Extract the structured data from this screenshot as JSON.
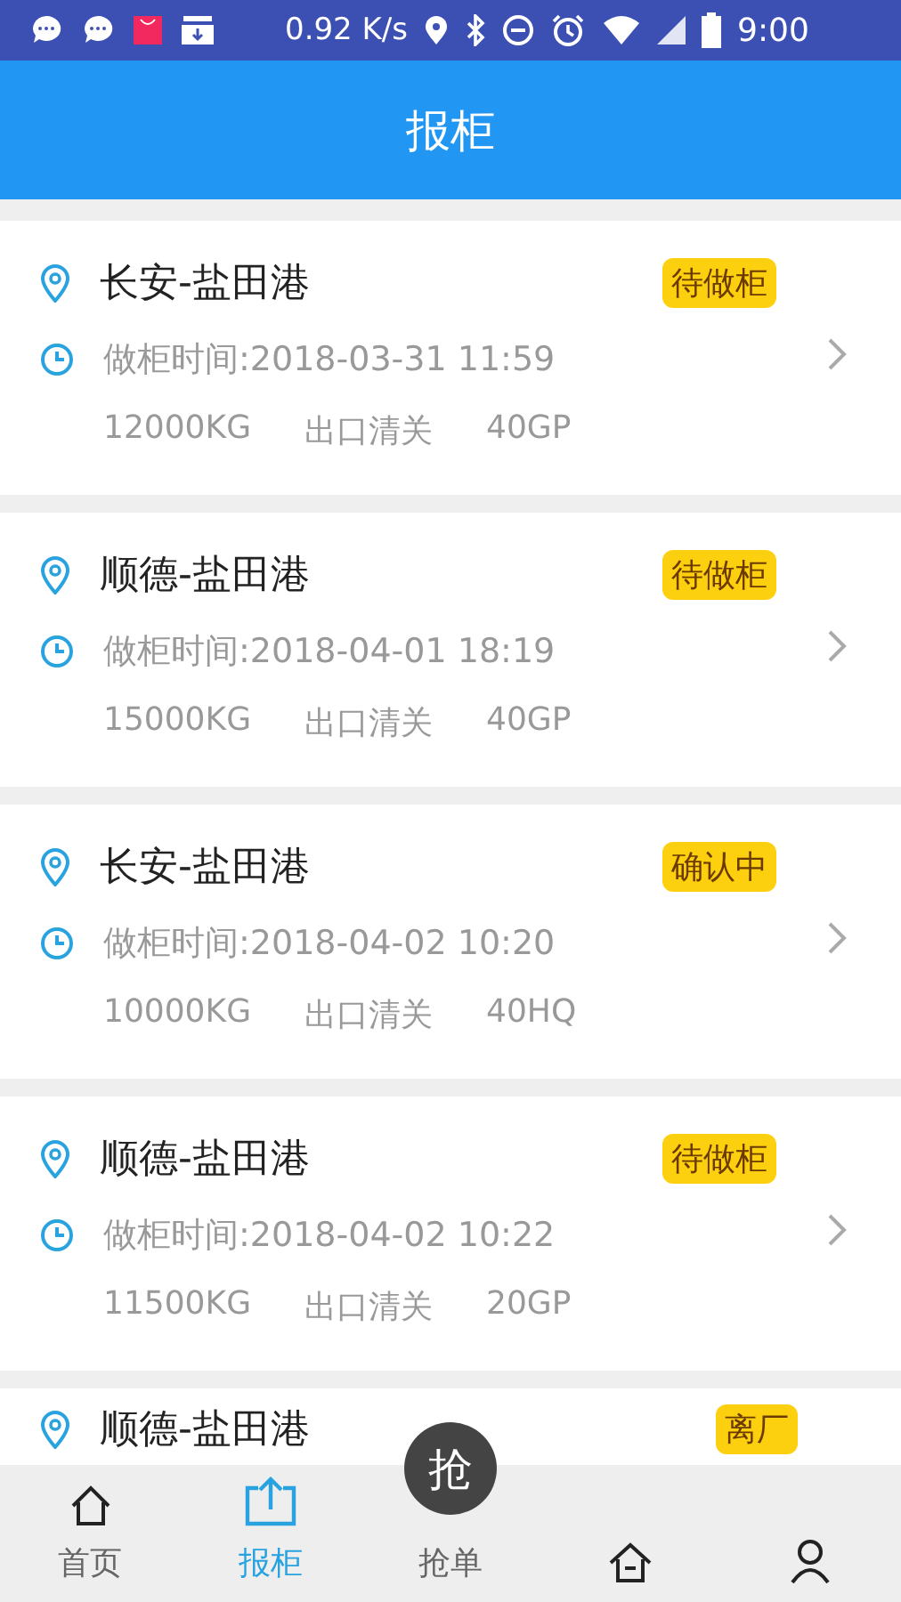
{
  "status_bar": {
    "speed": "0.92 K/s",
    "time": "9:00"
  },
  "header": {
    "title": "报柜"
  },
  "orders": [
    {
      "route": "长安-盐田港",
      "status": "待做柜",
      "time": "做柜时间:2018-03-31 11:59",
      "weight": "12000KG",
      "customs": "出口清关",
      "container": "40GP"
    },
    {
      "route": "顺德-盐田港",
      "status": "待做柜",
      "time": "做柜时间:2018-04-01 18:19",
      "weight": "15000KG",
      "customs": "出口清关",
      "container": "40GP"
    },
    {
      "route": "长安-盐田港",
      "status": "确认中",
      "time": "做柜时间:2018-04-02 10:20",
      "weight": "10000KG",
      "customs": "出口清关",
      "container": "40HQ"
    },
    {
      "route": "顺德-盐田港",
      "status": "待做柜",
      "time": "做柜时间:2018-04-02 10:22",
      "weight": "11500KG",
      "customs": "出口清关",
      "container": "20GP"
    },
    {
      "route": "顺德-盐田港",
      "status": "离厂"
    }
  ],
  "tabs": [
    {
      "kind": "home",
      "label": "首页",
      "selected": false
    },
    {
      "kind": "upload",
      "label": "报柜",
      "selected": true
    },
    {
      "kind": "grab",
      "badge": "抢",
      "label": "抢单",
      "selected": false
    },
    {
      "kind": "house",
      "selected": false
    },
    {
      "kind": "person",
      "selected": false
    }
  ]
}
